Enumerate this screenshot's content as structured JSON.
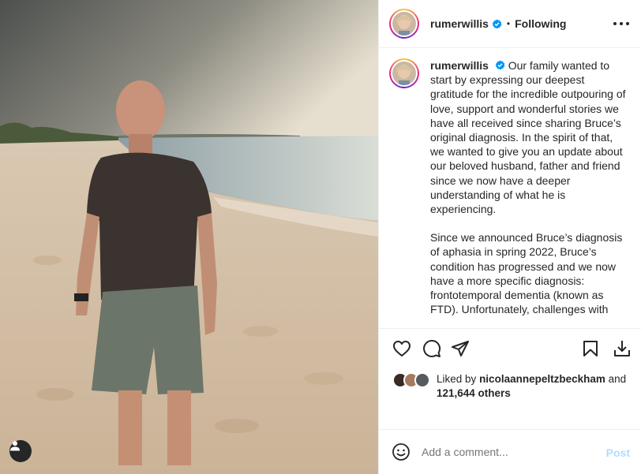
{
  "post": {
    "author": "rumerwillis",
    "follow_state": "Following",
    "separator": "•"
  },
  "caption": {
    "author": "rumerwillis",
    "paragraph_1": "Our family wanted to start by expressing our deepest gratitude for the incredible outpouring of love, support and wonderful stories we have all received since sharing Bruce’s original diagnosis. In the spirit of that, we wanted to give you an update about our beloved husband, father and friend since we now have a deeper understanding of what he is experiencing.",
    "paragraph_2": "Since we announced Bruce’s diagnosis of aphasia in spring 2022, Bruce’s condition has progressed and we now have a more specific diagnosis: frontotemporal dementia (known as FTD). Unfortunately, challenges with"
  },
  "likes": {
    "prefix": "Liked by",
    "user": "nicolaannepeltzbeckham",
    "conjunction": "and",
    "count": "121,644 others"
  },
  "comment": {
    "placeholder": "Add a comment...",
    "post_label": "Post"
  },
  "icons": {
    "like": "heart-icon",
    "comment": "comment-icon",
    "share": "paper-plane-icon",
    "save": "bookmark-icon",
    "download": "download-icon",
    "emoji": "emoji-icon",
    "tag": "user-tag-icon",
    "more": "more-options-icon",
    "verified": "verified-badge-icon"
  },
  "colors": {
    "verified": "#0095f6",
    "post_disabled": "#b3dbff",
    "text": "#262626",
    "muted": "#8e8e8e"
  }
}
